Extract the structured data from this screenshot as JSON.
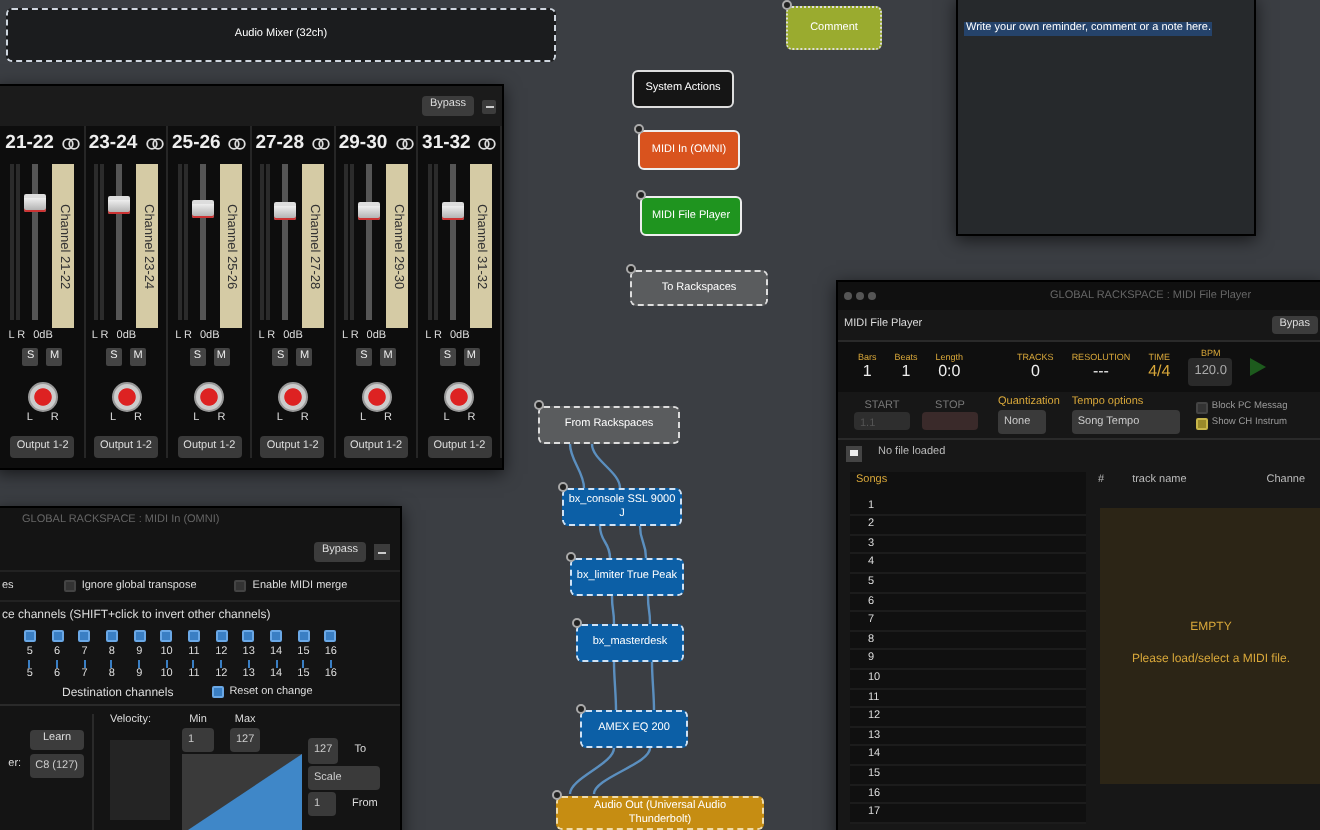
{
  "nodes": [
    {
      "label": "Audio Mixer (32ch)",
      "kind": "mixer",
      "color": "#1b1c1e"
    },
    {
      "label": "Comment",
      "kind": "comment",
      "color": "#9aab2f"
    },
    {
      "label": "System Actions",
      "kind": "system",
      "color": "#151515"
    },
    {
      "label": "MIDI In (OMNI)",
      "kind": "midi",
      "color": "#d9531e"
    },
    {
      "label": "MIDI File Player",
      "kind": "midi",
      "color": "#1f941f"
    },
    {
      "label": "To Rackspaces",
      "kind": "rack",
      "color": "#5a5c5e"
    },
    {
      "label": "From Rackspaces",
      "kind": "rack",
      "color": "#5a5c5e"
    },
    {
      "label": "bx_console SSL 9000 J",
      "kind": "plugin",
      "color": "#0c5fa6"
    },
    {
      "label": "bx_limiter True Peak",
      "kind": "plugin",
      "color": "#0c5fa6"
    },
    {
      "label": "bx_masterdesk",
      "kind": "plugin",
      "color": "#0c5fa6"
    },
    {
      "label": "AMEX EQ 200",
      "kind": "plugin",
      "color": "#0c5fa6"
    },
    {
      "label": "Audio Out (Universal Audio Thunderbolt)",
      "kind": "audio_out",
      "color": "#c68d12"
    }
  ],
  "mixer": {
    "bypass": "Bypass",
    "channels": [
      {
        "number": "21-22",
        "scribble": "Channel 21-22",
        "level": 0.78,
        "meter_labels": "L R",
        "zero_label": "0dB",
        "solo": "S",
        "mute": "M",
        "pan_left": "L",
        "pan_right": "R",
        "output": "Output 1-2"
      },
      {
        "number": "23-24",
        "scribble": "Channel 23-24",
        "level": 0.76,
        "meter_labels": "L R",
        "zero_label": "0dB",
        "solo": "S",
        "mute": "M",
        "pan_left": "L",
        "pan_right": "R",
        "output": "Output 1-2"
      },
      {
        "number": "25-26",
        "scribble": "Channel 25-26",
        "level": 0.74,
        "meter_labels": "L R",
        "zero_label": "0dB",
        "solo": "S",
        "mute": "M",
        "pan_left": "L",
        "pan_right": "R",
        "output": "Output 1-2"
      },
      {
        "number": "27-28",
        "scribble": "Channel 27-28",
        "level": 0.72,
        "meter_labels": "L R",
        "zero_label": "0dB",
        "solo": "S",
        "mute": "M",
        "pan_left": "L",
        "pan_right": "R",
        "output": "Output 1-2"
      },
      {
        "number": "29-30",
        "scribble": "Channel 29-30",
        "level": 0.72,
        "meter_labels": "L R",
        "zero_label": "0dB",
        "solo": "S",
        "mute": "M",
        "pan_left": "L",
        "pan_right": "R",
        "output": "Output 1-2"
      },
      {
        "number": "31-32",
        "scribble": "Channel 31-32",
        "level": 0.72,
        "meter_labels": "L R",
        "zero_label": "0dB",
        "solo": "S",
        "mute": "M",
        "pan_left": "L",
        "pan_right": "R",
        "output": "Output 1-2"
      }
    ]
  },
  "note": {
    "text": "Write your own reminder, comment or a note here."
  },
  "midi_in_panel": {
    "title": "GLOBAL RACKSPACE : MIDI In (OMNI)",
    "bypass": "Bypass",
    "cut_option": "es",
    "options": [
      {
        "label": "Ignore global transpose",
        "checked": false
      },
      {
        "label": "Enable MIDI merge",
        "checked": false
      }
    ],
    "source_heading": "ce channels (SHIFT+click to invert other channels)",
    "channels": [
      {
        "source": "5",
        "dest": "5",
        "checked": true
      },
      {
        "source": "6",
        "dest": "6",
        "checked": true
      },
      {
        "source": "7",
        "dest": "7",
        "checked": true
      },
      {
        "source": "8",
        "dest": "8",
        "checked": true
      },
      {
        "source": "9",
        "dest": "9",
        "checked": true
      },
      {
        "source": "10",
        "dest": "10",
        "checked": true
      },
      {
        "source": "11",
        "dest": "11",
        "checked": true
      },
      {
        "source": "12",
        "dest": "12",
        "checked": true
      },
      {
        "source": "13",
        "dest": "13",
        "checked": true
      },
      {
        "source": "14",
        "dest": "14",
        "checked": true
      },
      {
        "source": "15",
        "dest": "15",
        "checked": true
      },
      {
        "source": "16",
        "dest": "16",
        "checked": true
      }
    ],
    "dest_heading": "Destination channels",
    "reset": {
      "label": "Reset on change",
      "checked": true
    },
    "learn": "Learn",
    "trigger_label": "er:",
    "trigger_value": "C8 (127)",
    "velocity_label": "Velocity:",
    "min_label": "Min",
    "min": "1",
    "max_label": "Max",
    "max": "127",
    "to_value": "127",
    "to_label": "To",
    "mode": "Scale",
    "from_value": "1",
    "from_label": "From"
  },
  "player_panel": {
    "title": "GLOBAL RACKSPACE : MIDI File Player",
    "name": "MIDI File Player",
    "bypass": "Bypas",
    "stats": [
      {
        "label": "Bars",
        "value": "1",
        "kind": "value"
      },
      {
        "label": "Beats",
        "value": "1",
        "kind": "value"
      },
      {
        "label": "Length",
        "value": "0:0",
        "kind": "value"
      },
      {
        "label": "TRACKS",
        "value": "0",
        "kind": "value"
      },
      {
        "label": "RESOLUTION",
        "value": "---",
        "kind": "value"
      },
      {
        "label": "TIME",
        "value": "4/4",
        "kind": "value"
      },
      {
        "label": "BPM",
        "value": "120.0",
        "kind": "field"
      }
    ],
    "start_label": "START",
    "start": "1.1",
    "stop_label": "STOP",
    "quantization_label": "Quantization",
    "quantization": "None",
    "tempo_label": "Tempo options",
    "tempo": "Song Tempo",
    "options": [
      {
        "label": "Block PC Messag",
        "checked": false
      },
      {
        "label": "Show CH Instrum",
        "checked": true
      }
    ],
    "file_status": "No file loaded",
    "songs_heading": "Songs",
    "songs": [
      "1",
      "2",
      "3",
      "4",
      "5",
      "6",
      "7",
      "8",
      "9",
      "10",
      "11",
      "12",
      "13",
      "14",
      "15",
      "16",
      "17"
    ],
    "columns": [
      "#",
      "track name",
      "Channe"
    ],
    "empty_title": "EMPTY",
    "empty_message": "Please load/select a MIDI file."
  }
}
